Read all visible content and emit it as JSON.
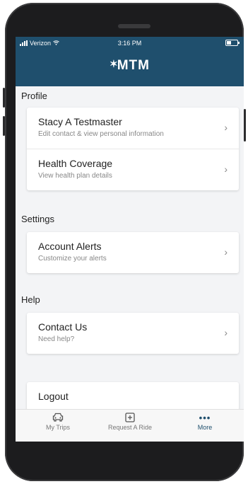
{
  "status_bar": {
    "carrier": "Verizon",
    "time": "3:16 PM"
  },
  "header": {
    "logo_text": "MTM"
  },
  "sections": {
    "profile": {
      "title": "Profile",
      "items": [
        {
          "title": "Stacy A Testmaster",
          "subtitle": "Edit contact & view personal information"
        },
        {
          "title": "Health Coverage",
          "subtitle": "View health plan details"
        }
      ]
    },
    "settings": {
      "title": "Settings",
      "items": [
        {
          "title": "Account Alerts",
          "subtitle": "Customize your alerts"
        }
      ]
    },
    "help": {
      "title": "Help",
      "items": [
        {
          "title": "Contact Us",
          "subtitle": "Need help?"
        }
      ]
    },
    "logout": {
      "label": "Logout"
    }
  },
  "bottom_nav": [
    {
      "label": "My Trips",
      "icon": "car-icon"
    },
    {
      "label": "Request A Ride",
      "icon": "plus-square-icon"
    },
    {
      "label": "More",
      "icon": "more-dots-icon"
    }
  ],
  "colors": {
    "header": "#1f4f6d",
    "active_tab": "#1f4f6d"
  }
}
